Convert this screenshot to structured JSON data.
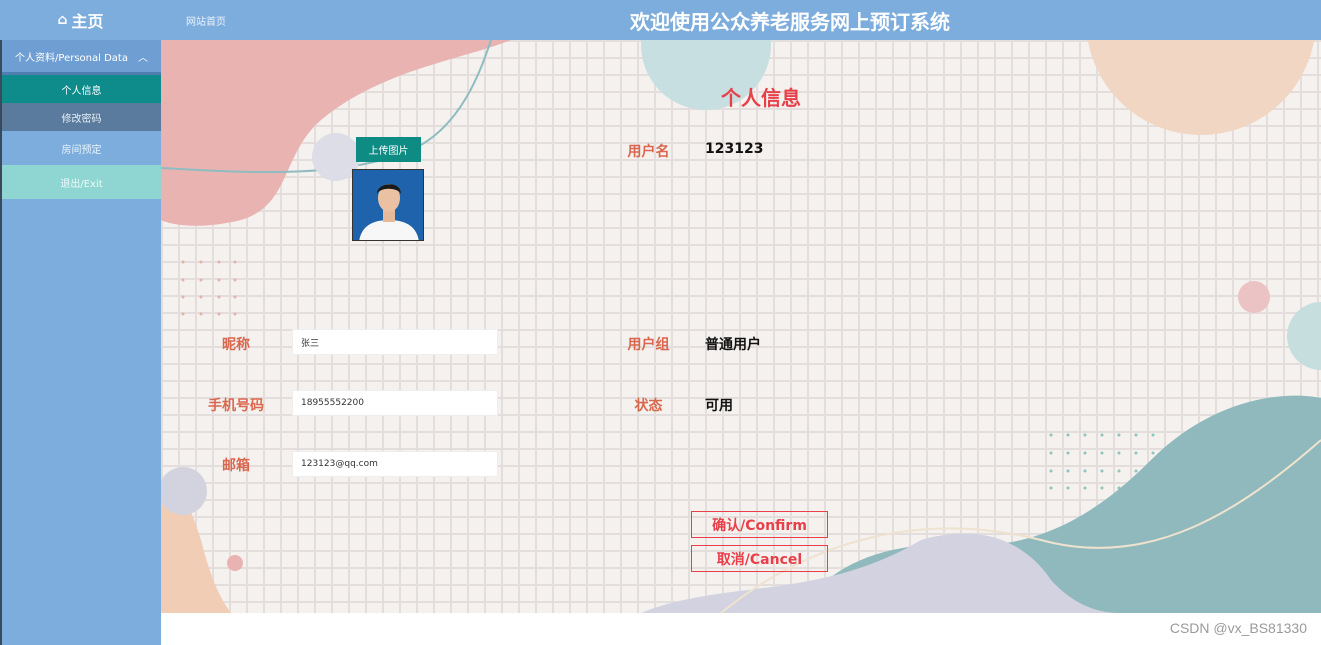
{
  "header": {
    "home_icon": "home-icon",
    "home_label": "主页",
    "site_link": "网站首页",
    "title": "欢迎使用公众养老服务网上预订系统"
  },
  "sidebar": {
    "group_label": "个人资料/Personal Data",
    "group_icon": "chevron-up-icon",
    "sub_items": [
      "个人信息",
      "修改密码"
    ],
    "items": [
      "房间预定",
      "退出/Exit"
    ]
  },
  "profile": {
    "page_title": "个人信息",
    "upload_label": "上传图片",
    "username_label": "用户名",
    "username_value": "123123",
    "nickname_label": "昵称",
    "nickname_value": "张三",
    "usergroup_label": "用户组",
    "usergroup_value": "普通用户",
    "phone_label": "手机号码",
    "phone_value": "18955552200",
    "status_label": "状态",
    "status_value": "可用",
    "email_label": "邮箱",
    "email_value": "123123@qq.com",
    "confirm_label": "确认/Confirm",
    "cancel_label": "取消/Cancel"
  },
  "watermark": "CSDN @vx_BS81330",
  "colors": {
    "topbar": "#7daddd",
    "active_item": "#0e8b8b",
    "accent_red": "#e8404a",
    "label_orange": "#d9674e"
  }
}
